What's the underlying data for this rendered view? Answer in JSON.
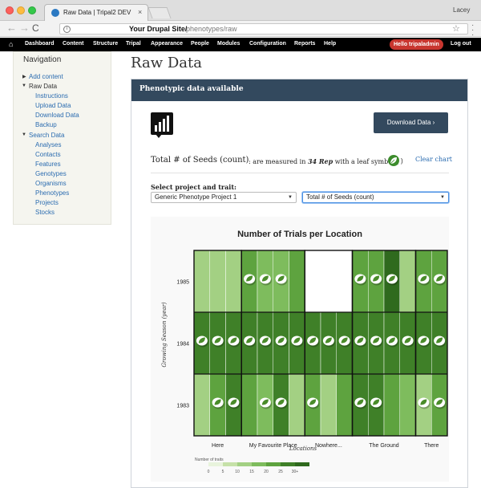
{
  "browser": {
    "tab_title": "Raw Data | Tripal2 DEV",
    "tab_close": "×",
    "profile": "Lacey",
    "url_host": "Your Drupal Site/",
    "url_path": "phenotypes/raw",
    "back": "←",
    "forward": "→",
    "reload": "C",
    "star": "☆",
    "info": "i"
  },
  "admin_bar": {
    "home": "⌂",
    "items": [
      "Dashboard",
      "Content",
      "Structure",
      "Tripal",
      "Appearance",
      "People",
      "Modules",
      "Configuration",
      "Reports",
      "Help"
    ],
    "hello": "Hello tripaladmin",
    "logout": "Log out"
  },
  "sidebar": {
    "heading": "Navigation",
    "add_content": "Add content",
    "raw_data": "Raw Data",
    "raw_children": [
      "Instructions",
      "Upload Data",
      "Download Data",
      "Backup"
    ],
    "search_data": "Search Data",
    "search_children": [
      "Analyses",
      "Contacts",
      "Features",
      "Genotypes",
      "Organisms",
      "Phenotypes",
      "Projects",
      "Stocks"
    ]
  },
  "page": {
    "title": "Raw Data",
    "panel_title": "Phenotypic data available",
    "download_button": "Download Data ›",
    "trait_name": "Total # of Seeds (count)",
    "trait_desc_prefix": ": are measured in ",
    "trait_rep": "34 Rep",
    "trait_desc_suffix": " with a leaf symbol (",
    "trait_paren_close": ")",
    "clear_chart": "Clear chart",
    "select_label": "Select project and trait:",
    "project_select": "Generic Phenotype Project 1",
    "trait_select": "Total # of Seeds (count)"
  },
  "colors": {
    "header": "#33495e",
    "leaf_badge": "#3c8c2c",
    "scale": [
      "#e8f3dc",
      "#c6e1a8",
      "#a3d083",
      "#7ebc5d",
      "#5ea33f",
      "#3f8028",
      "#2f6a1e"
    ]
  },
  "chart_data": {
    "type": "heatmap",
    "title": "Number of Trials per Location",
    "xlabel": "Locations",
    "ylabel": "Growing Season (year)",
    "locations": [
      "Here",
      "My Favourite Place",
      "Nowhere...",
      "The Ground",
      "There"
    ],
    "years": [
      "1985",
      "1984",
      "1983"
    ],
    "legend_title": "Number of traits",
    "legend_ticks": [
      "0",
      "5",
      "10",
      "15",
      "20",
      "25",
      "30+"
    ],
    "cells": [
      {
        "year": "1985",
        "levels": [
          2,
          2,
          2,
          4,
          3,
          3,
          4,
          -1,
          -1,
          -1,
          4,
          4,
          6,
          2,
          4,
          4
        ],
        "leaves": [
          0,
          0,
          0,
          1,
          1,
          1,
          0,
          0,
          0,
          0,
          1,
          1,
          1,
          0,
          1,
          1
        ]
      },
      {
        "year": "1984",
        "levels": [
          5,
          5,
          5,
          5,
          5,
          5,
          5,
          5,
          5,
          5,
          5,
          5,
          5,
          5,
          5,
          5
        ],
        "leaves": [
          1,
          1,
          1,
          1,
          1,
          1,
          1,
          1,
          1,
          1,
          1,
          1,
          1,
          1,
          1,
          1
        ]
      },
      {
        "year": "1983",
        "levels": [
          2,
          4,
          5,
          4,
          3,
          5,
          2,
          4,
          2,
          4,
          5,
          5,
          4,
          3,
          2,
          4
        ],
        "leaves": [
          0,
          1,
          1,
          0,
          1,
          1,
          0,
          1,
          0,
          0,
          1,
          1,
          0,
          0,
          1,
          1
        ]
      }
    ]
  }
}
